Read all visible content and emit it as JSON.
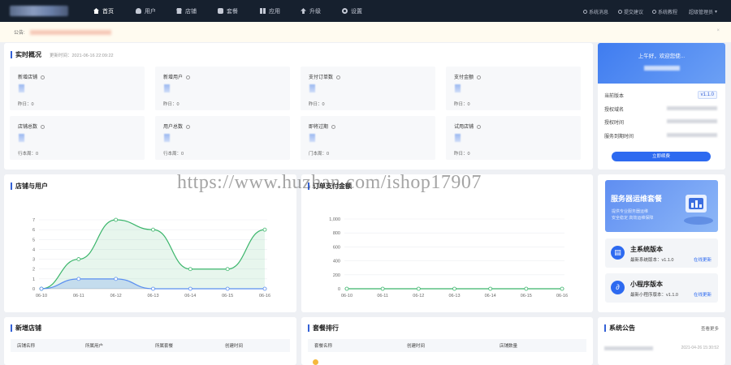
{
  "nav": {
    "items": [
      {
        "label": "首页",
        "icon": "home-icon",
        "active": true
      },
      {
        "label": "用户",
        "icon": "user-icon"
      },
      {
        "label": "店铺",
        "icon": "shop-icon"
      },
      {
        "label": "套餐",
        "icon": "money-icon"
      },
      {
        "label": "应用",
        "icon": "grid-icon"
      },
      {
        "label": "升级",
        "icon": "upgrade-icon"
      },
      {
        "label": "设置",
        "icon": "gear-icon"
      }
    ],
    "right_links": [
      "系统消息",
      "提交建议",
      "系统教程",
      "超级管理员"
    ]
  },
  "notice": {
    "label": "公告:"
  },
  "overview": {
    "title": "实时概况",
    "updated": "更新时间：2021-06-16 22:09:22",
    "stats": [
      {
        "label": "新增店铺",
        "sub": "昨日：0"
      },
      {
        "label": "新增用户",
        "sub": "昨日：0"
      },
      {
        "label": "支付订单数",
        "sub": "昨日：0"
      },
      {
        "label": "支付金额",
        "sub": "昨日：0"
      },
      {
        "label": "店铺总数",
        "sub": "行本周：0"
      },
      {
        "label": "用户总数",
        "sub": "行本周：0"
      },
      {
        "label": "即将过期",
        "sub": "门本周：0"
      },
      {
        "label": "试用店铺",
        "sub": "昨日：0"
      }
    ]
  },
  "welcome": {
    "greeting": "上午好，欢迎您使...",
    "rows": [
      "当前版本",
      "授权域名",
      "授权时间",
      "服务到期时间"
    ],
    "version": "v1.1.0",
    "button": "立即续费"
  },
  "shop_user_chart": {
    "title": "店铺与用户"
  },
  "order_chart": {
    "title": "订单支付金额"
  },
  "watermark": "https://www.huzhan.com/ishop17907",
  "promo": {
    "title": "服务器运维套餐",
    "line1": "提供专业服务器运维",
    "line2": "安全稳定 高效运维保障"
  },
  "versions": [
    {
      "title": "主系统版本",
      "sub": "最新系统版本：v1.1.0",
      "link": "在线更新",
      "icon": "system-icon"
    },
    {
      "title": "小程序版本",
      "sub": "最新小程序版本：v1.1.0",
      "link": "在线更新",
      "icon": "miniprogram-icon"
    }
  ],
  "new_shops": {
    "title": "新增店铺",
    "columns": [
      "店铺名称",
      "所属用户",
      "所属套餐",
      "创建时间"
    ]
  },
  "package_rank": {
    "title": "套餐排行",
    "columns": [
      "套餐名称",
      "创建时间",
      "店铺数量"
    ]
  },
  "announcement": {
    "title": "系统公告",
    "more": "查看更多",
    "date": "2021-04-26 15:30:52"
  },
  "chart_data": [
    {
      "type": "line",
      "title": "店铺与用户",
      "categories": [
        "06-10",
        "06-11",
        "06-12",
        "06-13",
        "06-14",
        "06-15",
        "06-16"
      ],
      "series": [
        {
          "values": [
            0,
            3,
            7,
            6,
            2,
            2,
            6
          ],
          "color": "#3bb56b"
        },
        {
          "values": [
            0,
            1,
            1,
            0,
            0,
            0,
            0
          ],
          "color": "#5b8ff0"
        }
      ],
      "ylim": [
        0,
        7
      ],
      "yticks": [
        0,
        1,
        2,
        3,
        4,
        5,
        6,
        7
      ]
    },
    {
      "type": "line",
      "title": "订单支付金额",
      "categories": [
        "06-10",
        "06-11",
        "06-12",
        "06-13",
        "06-14",
        "06-15",
        "06-16"
      ],
      "series": [
        {
          "values": [
            0,
            0,
            0,
            0,
            0,
            0,
            0
          ],
          "color": "#3bb56b"
        }
      ],
      "ylim": [
        0,
        1000
      ],
      "yticks": [
        "0",
        "200",
        "400",
        "600",
        "800",
        "1,000"
      ]
    }
  ]
}
